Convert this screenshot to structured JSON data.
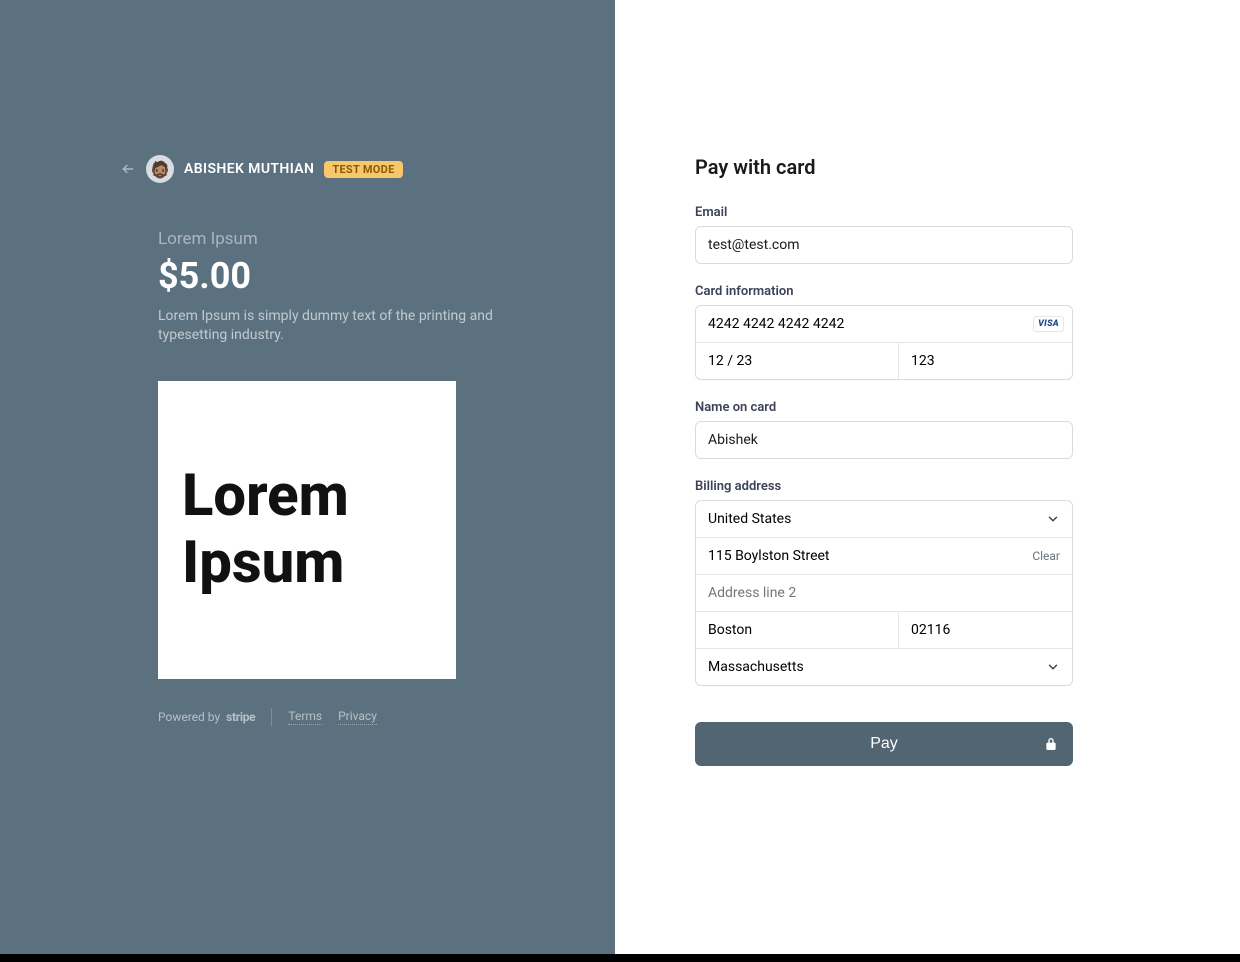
{
  "merchant": {
    "name": "ABISHEK MUTHIAN",
    "avatar_emoji": "🧔🏽",
    "badge": "TEST MODE"
  },
  "product": {
    "title": "Lorem Ipsum",
    "price": "$5.00",
    "description": "Lorem Ipsum is simply dummy text of the printing and typesetting industry.",
    "image_text": "Lorem Ipsum"
  },
  "footer": {
    "powered_by": "Powered by",
    "stripe": "stripe",
    "terms": "Terms",
    "privacy": "Privacy"
  },
  "form": {
    "heading": "Pay with card",
    "email": {
      "label": "Email",
      "value": "test@test.com"
    },
    "card": {
      "label": "Card information",
      "number": "4242 4242 4242 4242",
      "brand": "VISA",
      "expiry": "12 / 23",
      "cvc": "123"
    },
    "name": {
      "label": "Name on card",
      "value": "Abishek"
    },
    "billing": {
      "label": "Billing address",
      "country": "United States",
      "line1": "115 Boylston Street",
      "line2_placeholder": "Address line 2",
      "clear": "Clear",
      "city": "Boston",
      "postal": "02116",
      "state": "Massachusetts"
    },
    "pay_button": "Pay"
  },
  "colors": {
    "left_bg": "#5c7180",
    "accent": "#526572",
    "badge_bg": "#f7c76a"
  }
}
